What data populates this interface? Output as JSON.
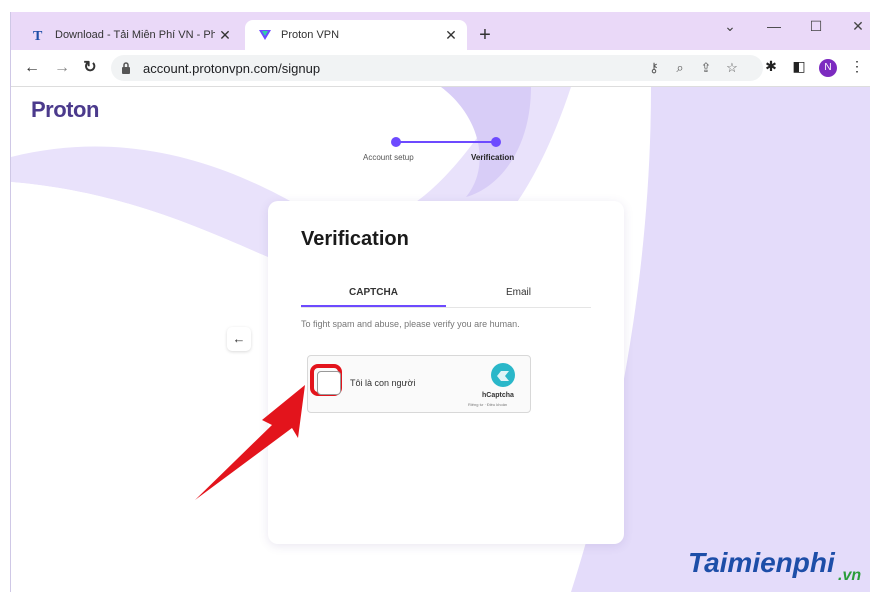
{
  "browser": {
    "tabs": [
      {
        "title": "Download - Tải Miễn Phí VN - Ph",
        "favicon": "T-icon"
      },
      {
        "title": "Proton VPN",
        "favicon": "proton-vpn-icon"
      }
    ],
    "new_tab_label": "+",
    "url": "account.protonvpn.com/signup",
    "profile_initial": "N"
  },
  "page": {
    "logo_text": "Proton",
    "steps": [
      "Account setup",
      "Verification"
    ],
    "card": {
      "title": "Verification",
      "tabs": [
        "CAPTCHA",
        "Email"
      ],
      "hint": "To fight spam and abuse, please verify you are human."
    },
    "hcaptcha": {
      "checkbox_label": "Tôi là con người",
      "brand": "hCaptcha",
      "small_text": "Riêng tư · Điều khoản"
    }
  },
  "watermark": {
    "main": "Taimienphi",
    "suffix": ".vn"
  },
  "colors": {
    "accent": "#6d4aff",
    "highlight": "#e3141c",
    "tab_strip": "#ead9f8"
  }
}
